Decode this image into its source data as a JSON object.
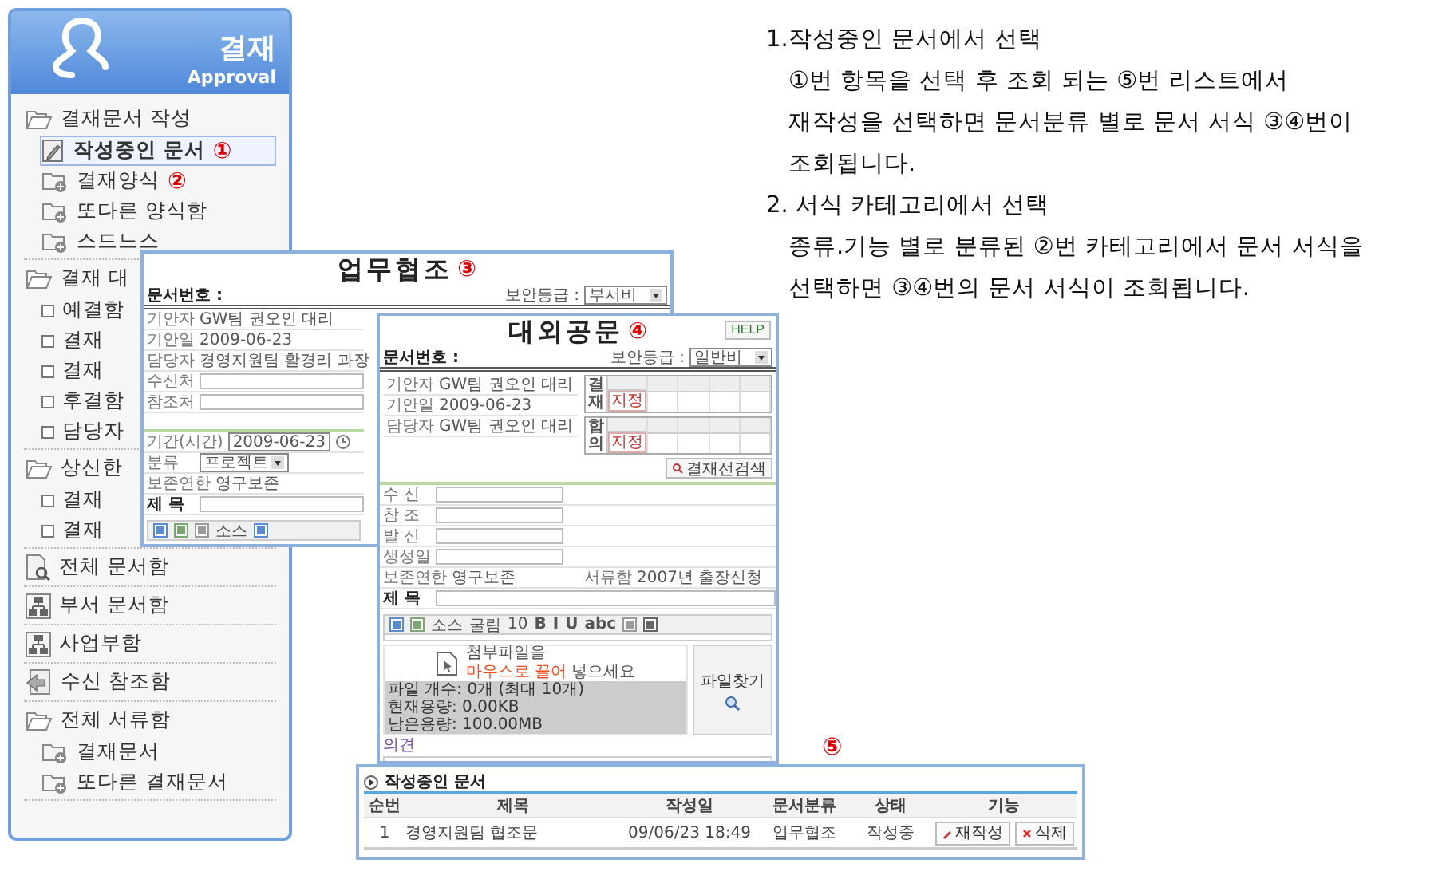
{
  "sidebar": {
    "title": "결재",
    "subtitle": "Approval",
    "items": [
      {
        "kind": "folder",
        "label": "결재문서 작성",
        "selected": false,
        "children": [
          {
            "kind": "doc",
            "label": "작성중인 문서",
            "marker": "①",
            "selected": true
          },
          {
            "kind": "subfolder",
            "label": "결재양식",
            "marker": "②",
            "selected": false
          },
          {
            "kind": "subfolder",
            "label": "또다른 양식함",
            "selected": false
          },
          {
            "kind": "subfolder",
            "label": "스드느스",
            "selected": false
          }
        ]
      },
      {
        "kind": "folder",
        "label": "결재 대",
        "selected": false,
        "children": [
          {
            "kind": "bullet",
            "label": "예결함",
            "selected": false
          },
          {
            "kind": "bullet",
            "label": "결재",
            "selected": false
          },
          {
            "kind": "bullet",
            "label": "결재",
            "selected": false
          },
          {
            "kind": "bullet",
            "label": "후결함",
            "selected": false
          },
          {
            "kind": "bullet",
            "label": "담당자",
            "selected": false
          }
        ]
      },
      {
        "kind": "folder",
        "label": "상신한",
        "selected": false,
        "children": [
          {
            "kind": "bullet",
            "label": "결재",
            "selected": false
          },
          {
            "kind": "bullet",
            "label": "결재",
            "selected": false
          }
        ]
      },
      {
        "kind": "search-doc",
        "label": "전체 문서함",
        "selected": false
      },
      {
        "kind": "org",
        "label": "부서 문서함",
        "selected": false
      },
      {
        "kind": "org",
        "label": "사업부함",
        "selected": false
      },
      {
        "kind": "ref",
        "label": "수신 참조함",
        "selected": false
      },
      {
        "kind": "folder",
        "label": "전체 서류함",
        "selected": false,
        "children": [
          {
            "kind": "subfolder",
            "label": "결재문서",
            "selected": false
          },
          {
            "kind": "subfolder",
            "label": "또다른 결재문서",
            "selected": false
          }
        ]
      }
    ]
  },
  "instructions": [
    {
      "heading": "1.작성중인 문서에서 선택",
      "lines": [
        "①번 항목을 선택 후 조회 되는 ⑤번 리스트에서",
        "재작성을 선택하면 문서분류 별로 문서 서식 ③④번이",
        "조회됩니다."
      ]
    },
    {
      "heading": "2. 서식 카테고리에서 선택",
      "lines": [
        "종류.기능 별로 분류된 ②번 카테고리에서 문서 서식을",
        "선택하면 ③④번의 문서 서식이 조회됩니다."
      ]
    }
  ],
  "form_3": {
    "title": "업무협조",
    "marker": "③",
    "doc_no_label": "문서번호 :",
    "security_label": "보안등급 :",
    "security_value": "부서비",
    "rows": [
      {
        "label": "기안자",
        "value": "GW팀 권오인 대리"
      },
      {
        "label": "기안일",
        "value": "2009-06-23"
      },
      {
        "label": "담당자",
        "value": "경영지원팀 활경리 과장"
      },
      {
        "label": "수신처",
        "kind": "input"
      },
      {
        "label": "참조처",
        "kind": "input"
      }
    ],
    "period_label": "기간(시간)",
    "period_value": "2009-06-23",
    "category_label": "분류",
    "category_value": "프로젝트",
    "retention_label": "보존연한",
    "retention_value": "영구보존",
    "subject_label": "제 목",
    "toolbar_text": "소스"
  },
  "form_4": {
    "title": "대외공문",
    "marker": "④",
    "help": "HELP",
    "doc_no_label": "문서번호 :",
    "security_label": "보안등급 :",
    "security_value": "일반비",
    "info": [
      {
        "label": "기안자",
        "value": "GW팀 권오인 대리"
      },
      {
        "label": "기안일",
        "value": "2009-06-23"
      },
      {
        "label": "담당자",
        "value": "GW팀 권오인 대리"
      }
    ],
    "approval": [
      {
        "label": "결재",
        "stamp": "지정"
      },
      {
        "label": "합의",
        "stamp": "지정"
      }
    ],
    "search_line": "결재선검색",
    "fields": [
      {
        "label": "수 신"
      },
      {
        "label": "참 조"
      },
      {
        "label": "발 신"
      },
      {
        "label": "생성일"
      }
    ],
    "retention_label": "보존연한",
    "retention_value": "영구보존",
    "cabinet_label": "서류함",
    "cabinet_value": "2007년 출장신청",
    "subject_label": "제 목",
    "toolbar": [
      "소스",
      "굴림",
      "10",
      "B",
      "I",
      "U",
      "abc"
    ],
    "attach_text": "첨부파일을",
    "attach_hint": "마우스로 끌어",
    "attach_tail": "넣으세요",
    "find_file": "파일찾기",
    "status": [
      "파일 개수: 0개 (최대 10개)",
      "현재용량: 0.00KB",
      "남은용량: 100.00MB"
    ],
    "opinion_label": "의견"
  },
  "list": {
    "marker": "⑤",
    "title": "작성중인 문서",
    "columns": [
      "순번",
      "제목",
      "작성일",
      "문서분류",
      "상태",
      "기능"
    ],
    "rows": [
      {
        "no": "1",
        "subject": "경영지원팀 협조문",
        "date": "09/06/23 18:49",
        "category": "업무협조",
        "status": "작성중",
        "actions": [
          "재작성",
          "삭제"
        ]
      }
    ]
  }
}
